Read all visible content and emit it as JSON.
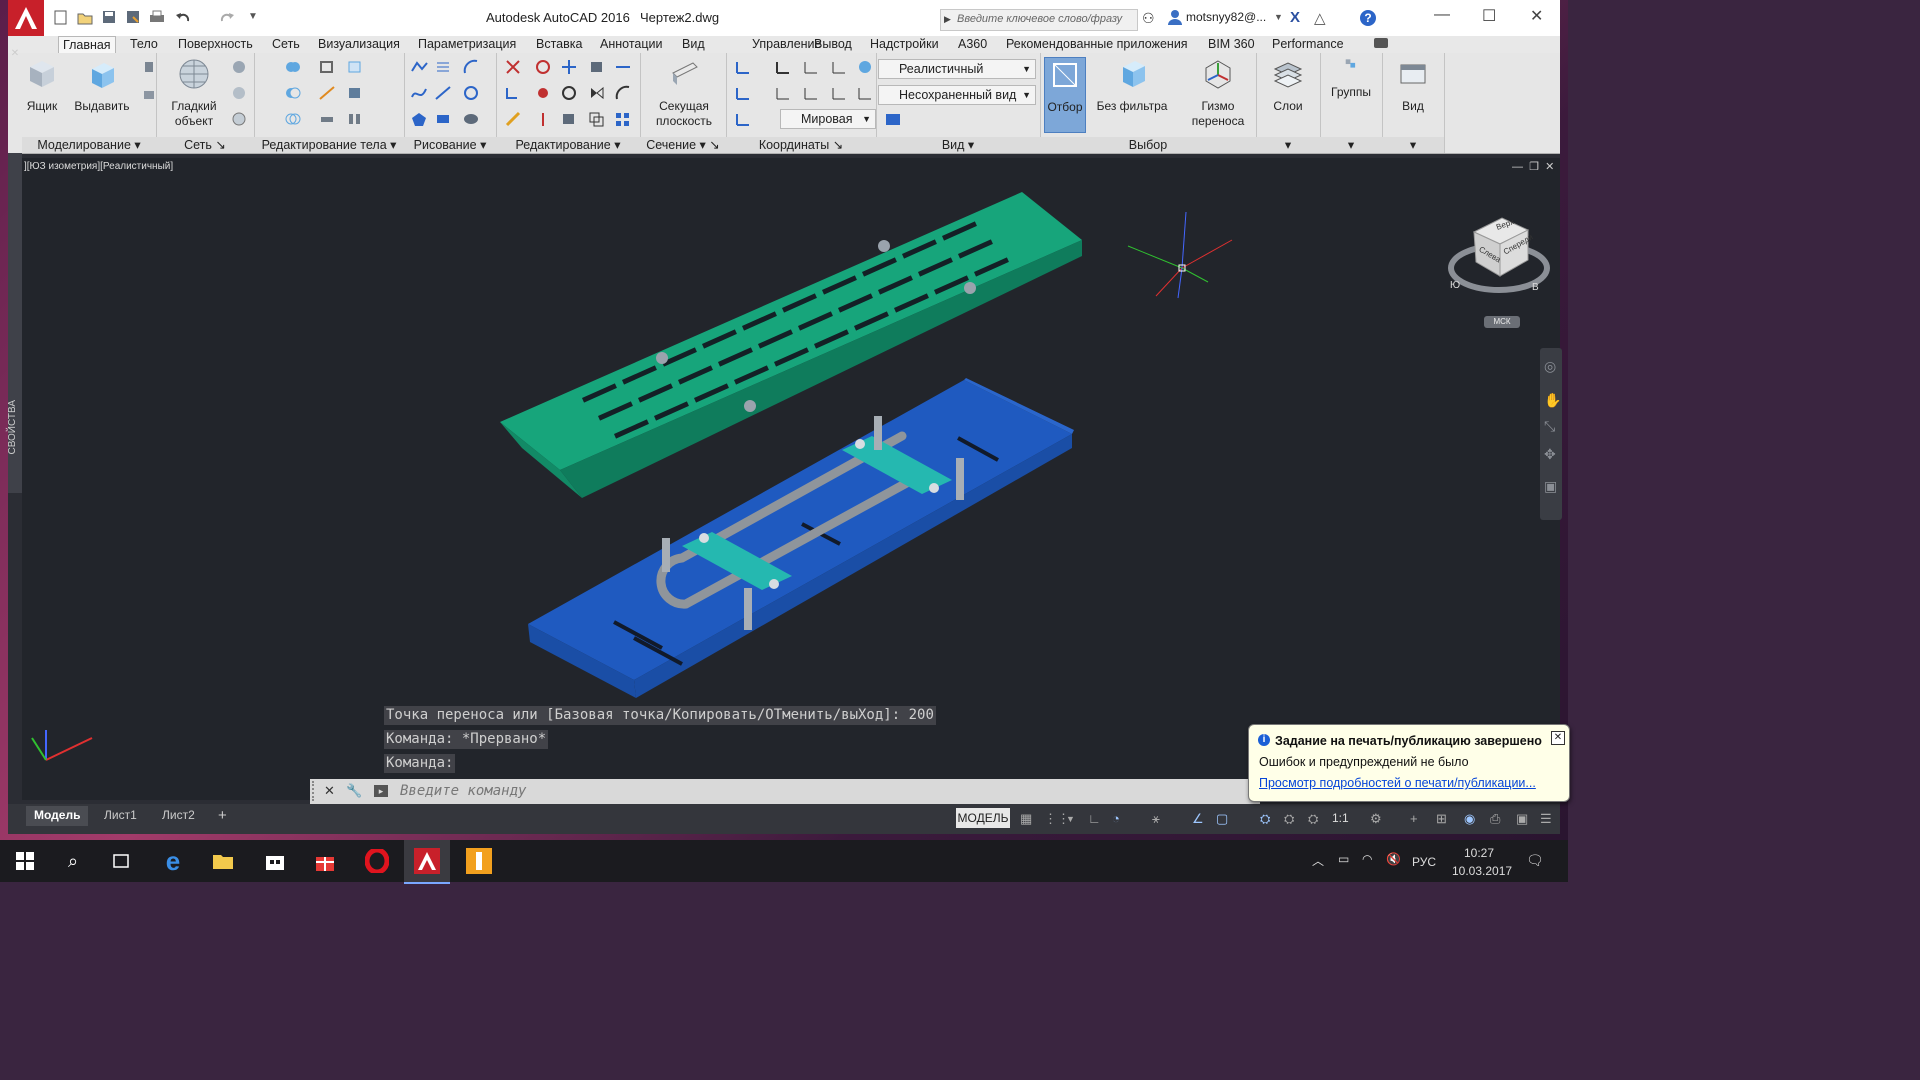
{
  "window": {
    "app_title": "Autodesk AutoCAD 2016",
    "file_title": "Чертеж2.dwg",
    "search_placeholder": "Введите ключевое слово/фразу",
    "user": "motsnyy82@..."
  },
  "menu_tabs": [
    "Главная",
    "Тело",
    "Поверхность",
    "Сеть",
    "Визуализация",
    "Параметризация",
    "Вставка",
    "Аннотации",
    "Вид",
    "Управление",
    "Вывод",
    "Надстройки",
    "A360",
    "Рекомендованные приложения",
    "BIM 360",
    "Performance"
  ],
  "ribbon": {
    "panels": [
      "Моделирование",
      "Сеть",
      "Редактирование тела",
      "Рисование",
      "Редактирование",
      "Сечение",
      "Координаты",
      "Вид",
      "Выбор"
    ],
    "big_buttons": {
      "box": "Ящик",
      "extrude": "Выдавить",
      "smooth_object_1": "Гладкий",
      "smooth_object_2": "объект",
      "section_plane_1": "Секущая",
      "section_plane_2": "плоскость",
      "culling": "Отбор",
      "no_filter": "Без фильтра",
      "gizmo_1": "Гизмо",
      "gizmo_2": "переноса",
      "layers": "Слои",
      "groups": "Группы",
      "view": "Вид"
    },
    "visual_style": "Реалистичный",
    "named_view": "Несохраненный вид",
    "ucs": "Мировая"
  },
  "sidebar": {
    "properties_label": "СВОЙСТВА"
  },
  "viewport": {
    "label": "][ЮЗ изометрия][Реалистичный]",
    "viewcube": {
      "top": "Верх",
      "left": "Слева",
      "front": "Спереди",
      "wcs": "МСК",
      "south": "Ю",
      "east": "В"
    }
  },
  "command": {
    "history": [
      "Точка переноса или [Базовая точка/Копировать/ОТменить/выХод]: 200",
      "Команда: *Прервано*",
      "Команда:"
    ],
    "input_placeholder": "Введите команду"
  },
  "layout_tabs": [
    "Модель",
    "Лист1",
    "Лист2"
  ],
  "status": {
    "model_button": "МОДЕЛЬ",
    "scale": "1:1"
  },
  "notification": {
    "title": "Задание на печать/публикацию завершено",
    "subtitle": "Ошибок и предупреждений не было",
    "link": "Просмотр подробностей о печати/публикации..."
  },
  "taskbar": {
    "language": "РУС",
    "time": "10:27",
    "date": "10.03.2017"
  },
  "colors": {
    "green_cover": "#16a37a",
    "blue_tray": "#1e56b8",
    "teal_bracket": "#23b7b0",
    "viewport_bg": "#22252b"
  }
}
